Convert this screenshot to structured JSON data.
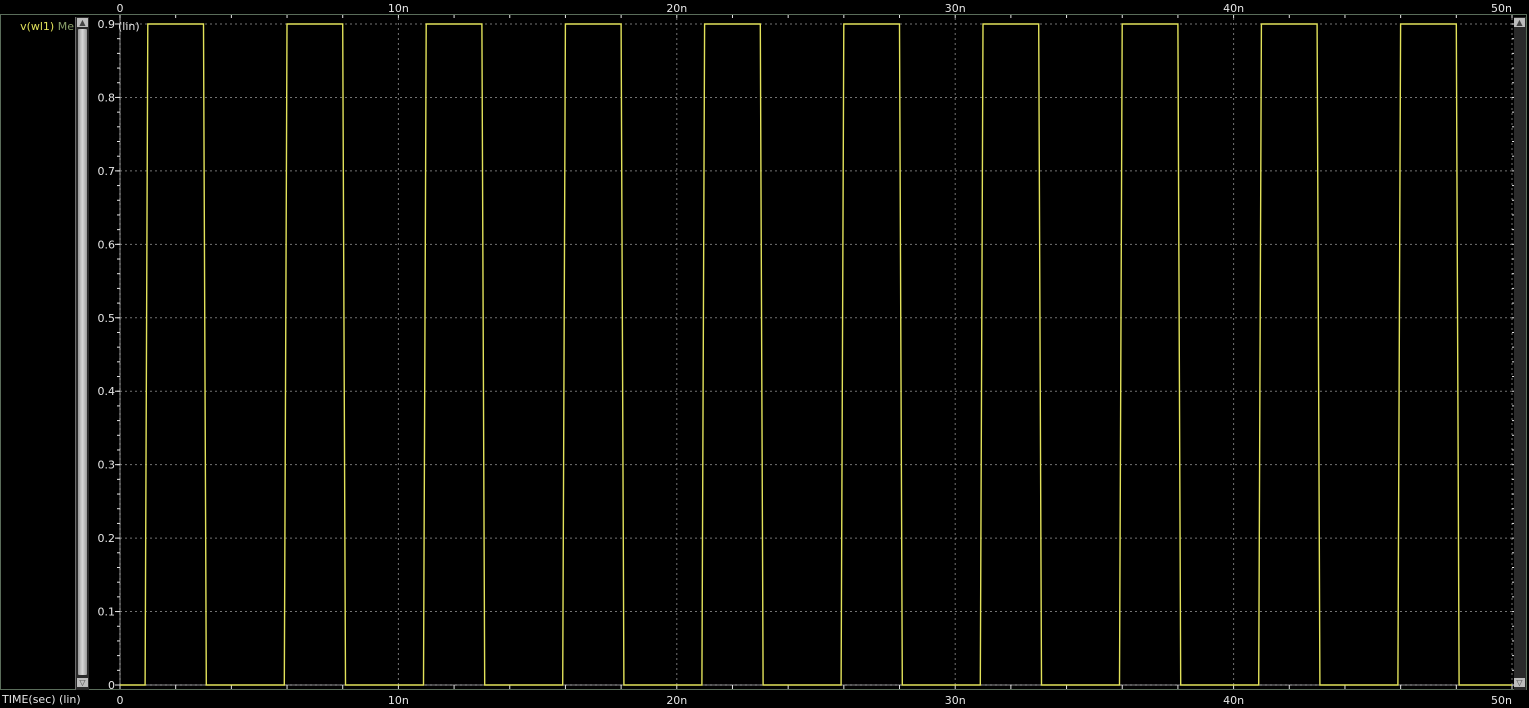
{
  "colors": {
    "background": "#000000",
    "trace": "#e2e25a",
    "grid": "#9a9a9a",
    "text": "#e6e6e6",
    "border": "#5a6d5a"
  },
  "signal_panel": {
    "signal_name": "v(wl1)",
    "signal_suffix": "Me"
  },
  "scroll_icons": {
    "up": "▲",
    "down": "▽"
  },
  "chart_data": {
    "type": "line",
    "x_title": "TIME(sec) (lin)",
    "y_unit_label": "(lin)",
    "xlim": [
      0,
      5e-08
    ],
    "ylim": [
      0,
      0.9
    ],
    "grid": true,
    "x_ticks": [
      {
        "value": 0,
        "label": "0"
      },
      {
        "value": 1e-08,
        "label": "10n"
      },
      {
        "value": 2e-08,
        "label": "20n"
      },
      {
        "value": 3e-08,
        "label": "30n"
      },
      {
        "value": 4e-08,
        "label": "40n"
      },
      {
        "value": 5e-08,
        "label": "50n"
      }
    ],
    "y_ticks": [
      {
        "value": 0,
        "label": "0"
      },
      {
        "value": 0.1,
        "label": "0.1"
      },
      {
        "value": 0.2,
        "label": "0.2"
      },
      {
        "value": 0.3,
        "label": "0.3"
      },
      {
        "value": 0.4,
        "label": "0.4"
      },
      {
        "value": 0.5,
        "label": "0.5"
      },
      {
        "value": 0.6,
        "label": "0.6"
      },
      {
        "value": 0.7,
        "label": "0.7"
      },
      {
        "value": 0.8,
        "label": "0.8"
      },
      {
        "value": 0.9,
        "label": "0.9"
      }
    ],
    "series": [
      {
        "name": "v(wl1)",
        "x": [
          0,
          9e-10,
          1e-09,
          3e-09,
          3.1e-09,
          5.9e-09,
          6e-09,
          8e-09,
          8.1e-09,
          1.09e-08,
          1.1e-08,
          1.3e-08,
          1.31e-08,
          1.59e-08,
          1.6e-08,
          1.8e-08,
          1.81e-08,
          2.09e-08,
          2.1e-08,
          2.3e-08,
          2.31e-08,
          2.59e-08,
          2.6e-08,
          2.8e-08,
          2.81e-08,
          3.09e-08,
          3.1e-08,
          3.3e-08,
          3.31e-08,
          3.59e-08,
          3.6e-08,
          3.8e-08,
          3.81e-08,
          4.09e-08,
          4.1e-08,
          4.3e-08,
          4.31e-08,
          4.59e-08,
          4.6e-08,
          4.8e-08,
          4.81e-08,
          5e-08
        ],
        "y": [
          0,
          0,
          0.9,
          0.9,
          0,
          0,
          0.9,
          0.9,
          0,
          0,
          0.9,
          0.9,
          0,
          0,
          0.9,
          0.9,
          0,
          0,
          0.9,
          0.9,
          0,
          0,
          0.9,
          0.9,
          0,
          0,
          0.9,
          0.9,
          0,
          0,
          0.9,
          0.9,
          0,
          0,
          0.9,
          0.9,
          0,
          0,
          0.9,
          0.9,
          0,
          0
        ]
      }
    ]
  }
}
